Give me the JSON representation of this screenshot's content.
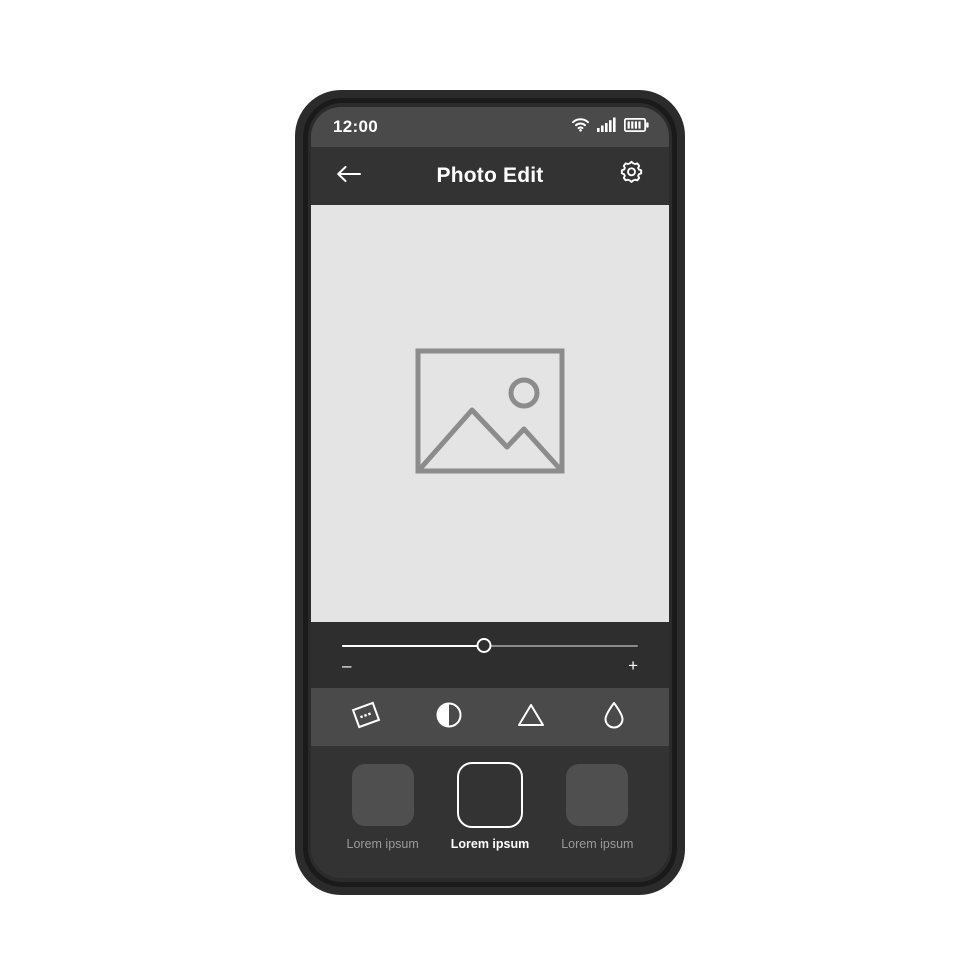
{
  "status_bar": {
    "time": "12:00",
    "icons": [
      "wifi-icon",
      "cellular-signal-icon",
      "battery-icon"
    ]
  },
  "header": {
    "back_icon": "back-arrow-icon",
    "title": "Photo Edit",
    "settings_icon": "gear-icon"
  },
  "canvas": {
    "placeholder_icon": "image-placeholder-icon"
  },
  "slider": {
    "value_percent": 48,
    "decrease_label": "–",
    "increase_label": "+"
  },
  "tools": [
    {
      "name": "effects-tool",
      "icon": "tilted-square-dots-icon"
    },
    {
      "name": "contrast-tool",
      "icon": "contrast-half-circle-icon"
    },
    {
      "name": "sharpen-tool",
      "icon": "triangle-icon"
    },
    {
      "name": "saturation-tool",
      "icon": "droplet-icon"
    }
  ],
  "filters": [
    {
      "label": "Lorem ipsum",
      "selected": false
    },
    {
      "label": "Lorem ipsum",
      "selected": true
    },
    {
      "label": "Lorem ipsum",
      "selected": false
    }
  ],
  "colors": {
    "frame": "#2b2b2b",
    "frame_ring": "#1a1a1a",
    "status_bar_bg": "#4a4a4a",
    "header_bg": "#333333",
    "canvas_bg": "#e4e4e4",
    "slider_panel_bg": "#2e2e2e",
    "tools_bg": "#4a4a4a",
    "filters_bg": "#333333",
    "accent": "#ffffff",
    "muted_text": "#9a9a9a",
    "placeholder_stroke": "#8c8c8c"
  }
}
